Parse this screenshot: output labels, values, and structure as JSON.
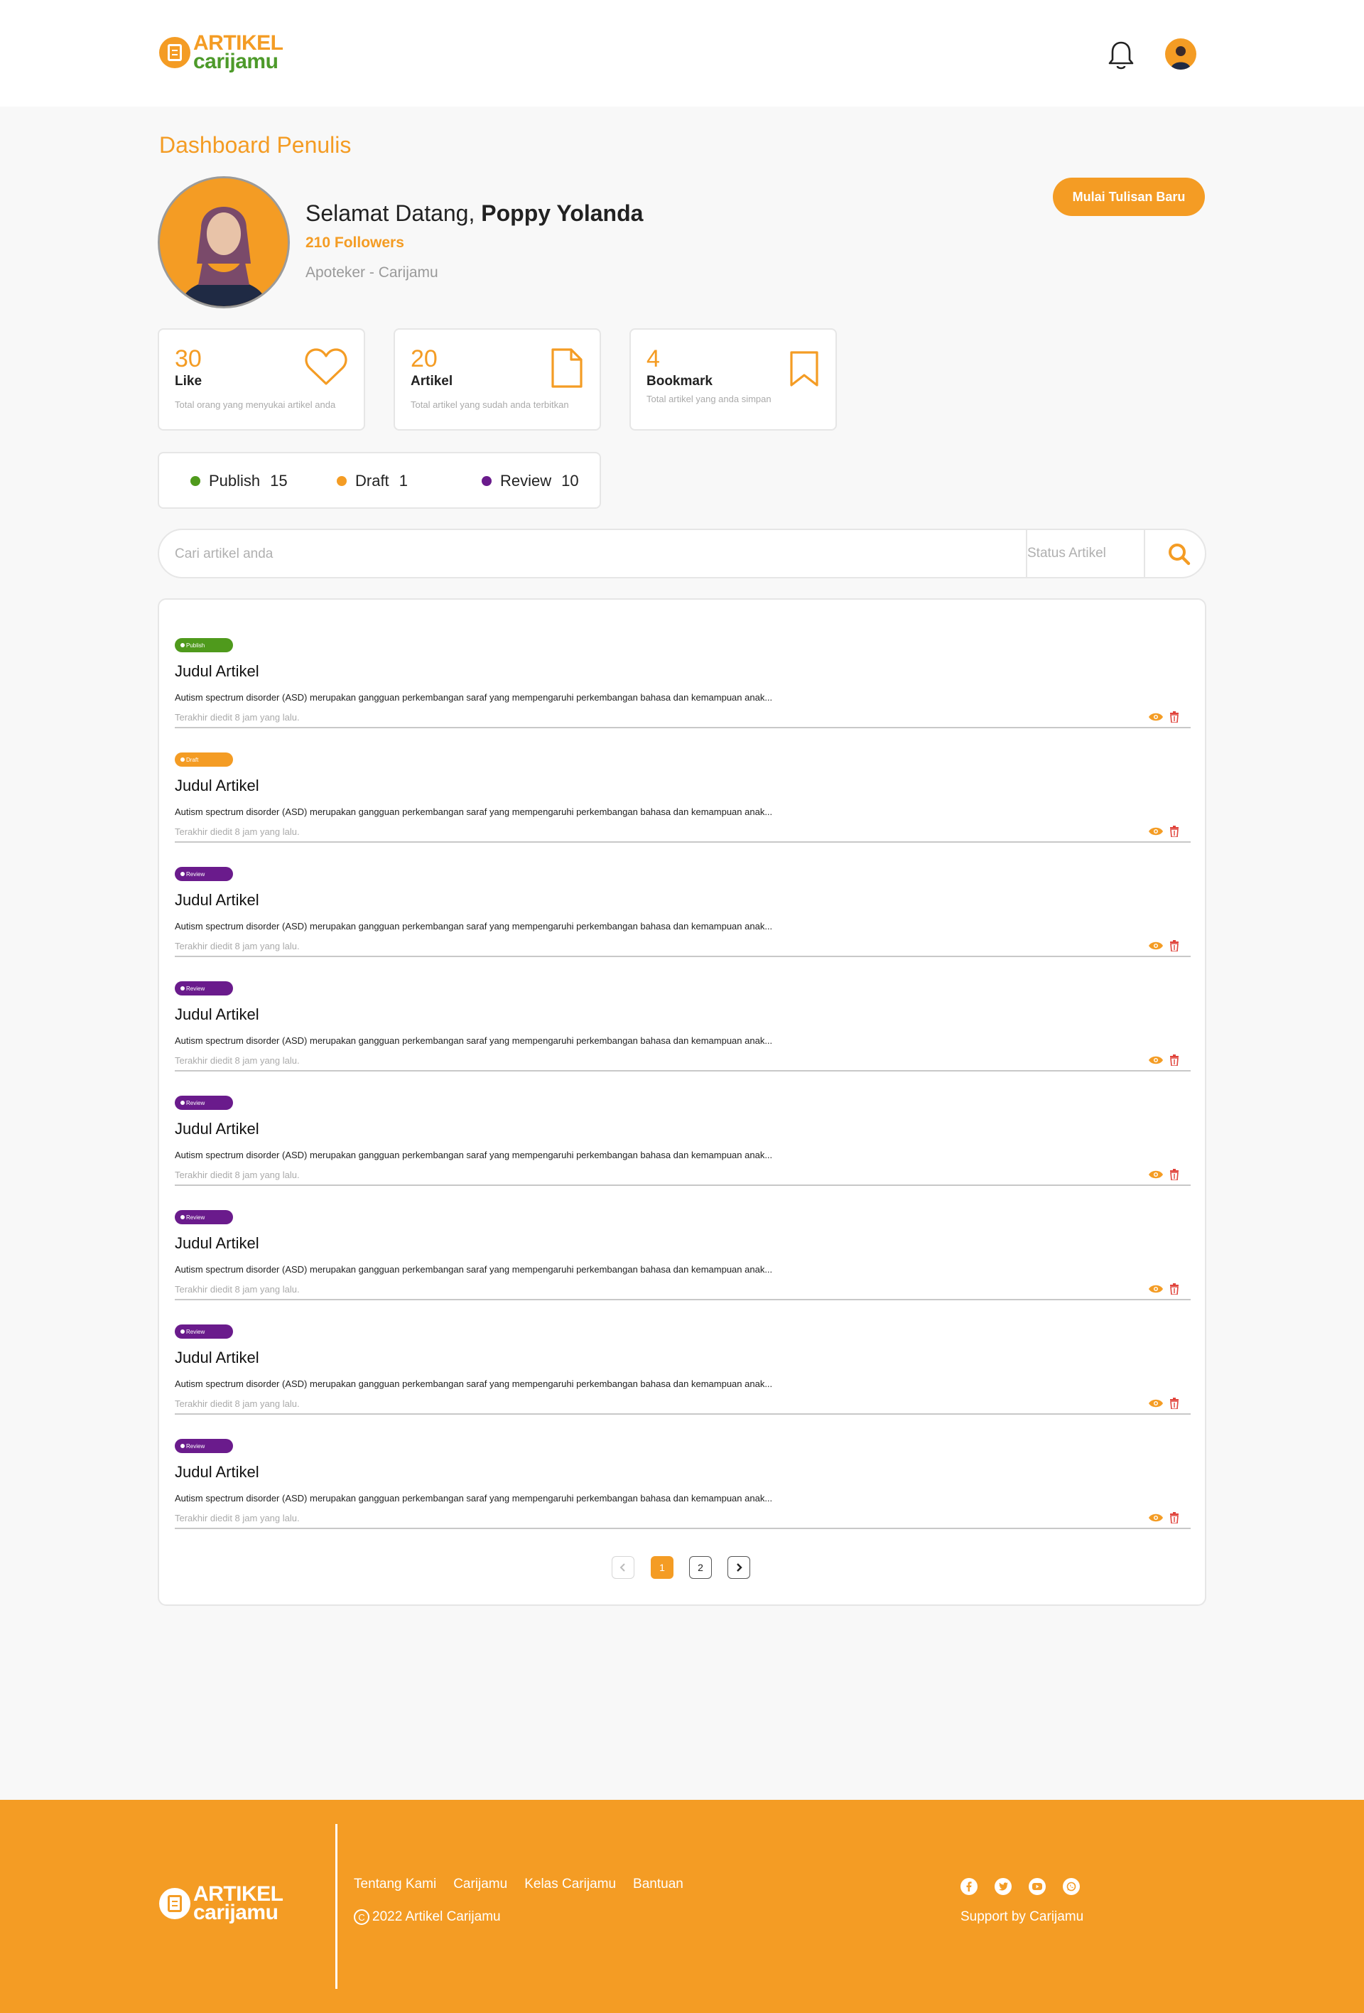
{
  "header": {
    "logo_line1": "ARTIKEL",
    "logo_line2": "carijamu",
    "notification_icon": "bell-icon",
    "avatar_icon": "user-avatar"
  },
  "page": {
    "title": "Dashboard Penulis",
    "welcome_prefix": "Selamat Datang, ",
    "user_name": "Poppy Yolanda",
    "followers": "210 Followers",
    "job": "Apoteker - Carijamu",
    "new_post_button": "Mulai Tulisan Baru"
  },
  "stats": [
    {
      "value": "30",
      "label": "Like",
      "desc": "Total orang yang menyukai artikel anda",
      "icon": "heart-icon"
    },
    {
      "value": "20",
      "label": "Artikel",
      "desc": "Total artikel yang sudah anda terbitkan",
      "icon": "document-icon"
    },
    {
      "value": "4",
      "label": "Bookmark",
      "desc": "Total artikel yang anda simpan",
      "icon": "bookmark-icon"
    }
  ],
  "status_summary": [
    {
      "label": "Publish",
      "count": "15",
      "color": "#4f9a1c"
    },
    {
      "label": "Draft",
      "count": "1",
      "color": "#f49c24"
    },
    {
      "label": "Review",
      "count": "10",
      "color": "#6a1b8c"
    }
  ],
  "search": {
    "placeholder": "Cari artikel anda",
    "status_placeholder": "Status Artikel",
    "icon": "search-icon"
  },
  "articles": [
    {
      "status": "Publish",
      "color": "#4f9a1c",
      "title": "Judul Artikel",
      "excerpt": "Autism spectrum disorder (ASD) merupakan gangguan perkembangan saraf yang mempengaruhi perkembangan bahasa dan kemampuan anak...",
      "time": "Terakhir diedit 8 jam yang lalu."
    },
    {
      "status": "Draft",
      "color": "#f49c24",
      "title": "Judul Artikel",
      "excerpt": "Autism spectrum disorder (ASD) merupakan gangguan perkembangan saraf yang mempengaruhi perkembangan bahasa dan kemampuan anak...",
      "time": "Terakhir diedit 8 jam yang lalu."
    },
    {
      "status": "Review",
      "color": "#6a1b8c",
      "title": "Judul Artikel",
      "excerpt": "Autism spectrum disorder (ASD) merupakan gangguan perkembangan saraf yang mempengaruhi perkembangan bahasa dan kemampuan anak...",
      "time": "Terakhir diedit 8 jam yang lalu."
    },
    {
      "status": "Review",
      "color": "#6a1b8c",
      "title": "Judul Artikel",
      "excerpt": "Autism spectrum disorder (ASD) merupakan gangguan perkembangan saraf yang mempengaruhi perkembangan bahasa dan kemampuan anak...",
      "time": "Terakhir diedit 8 jam yang lalu."
    },
    {
      "status": "Review",
      "color": "#6a1b8c",
      "title": "Judul Artikel",
      "excerpt": "Autism spectrum disorder (ASD) merupakan gangguan perkembangan saraf yang mempengaruhi perkembangan bahasa dan kemampuan anak...",
      "time": "Terakhir diedit 8 jam yang lalu."
    },
    {
      "status": "Review",
      "color": "#6a1b8c",
      "title": "Judul Artikel",
      "excerpt": "Autism spectrum disorder (ASD) merupakan gangguan perkembangan saraf yang mempengaruhi perkembangan bahasa dan kemampuan anak...",
      "time": "Terakhir diedit 8 jam yang lalu."
    },
    {
      "status": "Review",
      "color": "#6a1b8c",
      "title": "Judul Artikel",
      "excerpt": "Autism spectrum disorder (ASD) merupakan gangguan perkembangan saraf yang mempengaruhi perkembangan bahasa dan kemampuan anak...",
      "time": "Terakhir diedit 8 jam yang lalu."
    },
    {
      "status": "Review",
      "color": "#6a1b8c",
      "title": "Judul Artikel",
      "excerpt": "Autism spectrum disorder (ASD) merupakan gangguan perkembangan saraf yang mempengaruhi perkembangan bahasa dan kemampuan anak...",
      "time": "Terakhir diedit 8 jam yang lalu."
    }
  ],
  "pagination": {
    "prev_icon": "chevron-left-icon",
    "pages": [
      "1",
      "2"
    ],
    "current": "1",
    "next_icon": "chevron-right-icon"
  },
  "footer": {
    "logo_line1": "ARTIKEL",
    "logo_line2": "carijamu",
    "links": [
      "Tentang Kami",
      "Carijamu",
      "Kelas Carijamu",
      "Bantuan"
    ],
    "copyright": "2022 Artikel Carijamu",
    "social_icons": [
      "facebook-icon",
      "twitter-icon",
      "youtube-icon",
      "whatsapp-icon"
    ],
    "support": "Support by Carijamu"
  },
  "colors": {
    "accent": "#f49c24",
    "publish": "#4f9a1c",
    "review": "#6a1b8c",
    "delete": "#e0443c"
  }
}
